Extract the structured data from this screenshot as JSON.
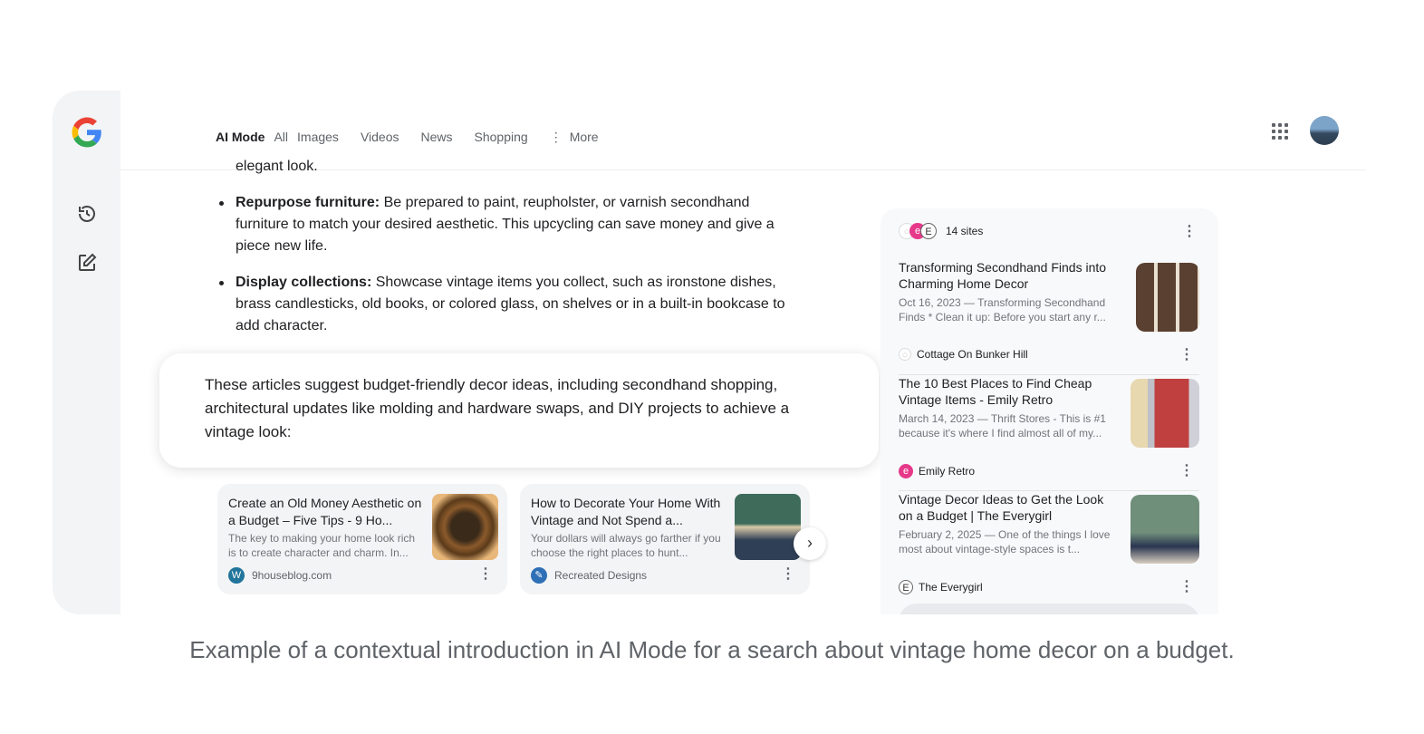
{
  "header": {
    "tabs": [
      "AI Mode",
      "All",
      "Images",
      "Videos",
      "News",
      "Shopping"
    ],
    "more": "More"
  },
  "answer": {
    "fragment": "elegant look.",
    "bullets": [
      {
        "bold": "Repurpose furniture:",
        "text": " Be prepared to paint, reupholster, or varnish secondhand furniture to match your desired aesthetic. This upcycling can save money and give a piece new life."
      },
      {
        "bold": "Display collections:",
        "text": " Showcase vintage items you collect, such as ironstone dishes, brass candlesticks, old books, or colored glass, on shelves or in a built-in bookcase to add character."
      }
    ],
    "intro": "These articles suggest budget-friendly decor ideas, including secondhand shopping, architectural updates like molding and hardware swaps, and DIY projects to achieve a vintage look:"
  },
  "cards": [
    {
      "title": "Create an Old Money Aesthetic on a Budget – Five Tips - 9 Ho...",
      "desc": "The key to making your home look rich is to create character and charm. In...",
      "source": "9houseblog.com"
    },
    {
      "title": "How to Decorate Your Home With Vintage and Not Spend a...",
      "desc": "Your dollars will always go farther if you choose the right places to hunt...",
      "source": "Recreated Designs"
    }
  ],
  "panel": {
    "count": "14 sites",
    "items": [
      {
        "title": "Transforming Secondhand Finds into Charming Home Decor",
        "desc": "Oct 16, 2023 — Transforming Secondhand Finds * Clean it up: Before you start any r...",
        "source": "Cottage On Bunker Hill"
      },
      {
        "title": "The 10 Best Places to Find Cheap Vintage Items - Emily Retro",
        "desc": "March 14, 2023 — Thrift Stores - This is #1 because it's where I find almost all of my...",
        "source": "Emily Retro"
      },
      {
        "title": "Vintage Decor Ideas to Get the Look on a Budget | The Everygirl",
        "desc": "February 2, 2025 — One of the things I love most about vintage-style spaces is t...",
        "source": "The Everygirl"
      }
    ]
  },
  "caption": "Example of a contextual introduction in AI Mode for a search about vintage home decor on a budget."
}
